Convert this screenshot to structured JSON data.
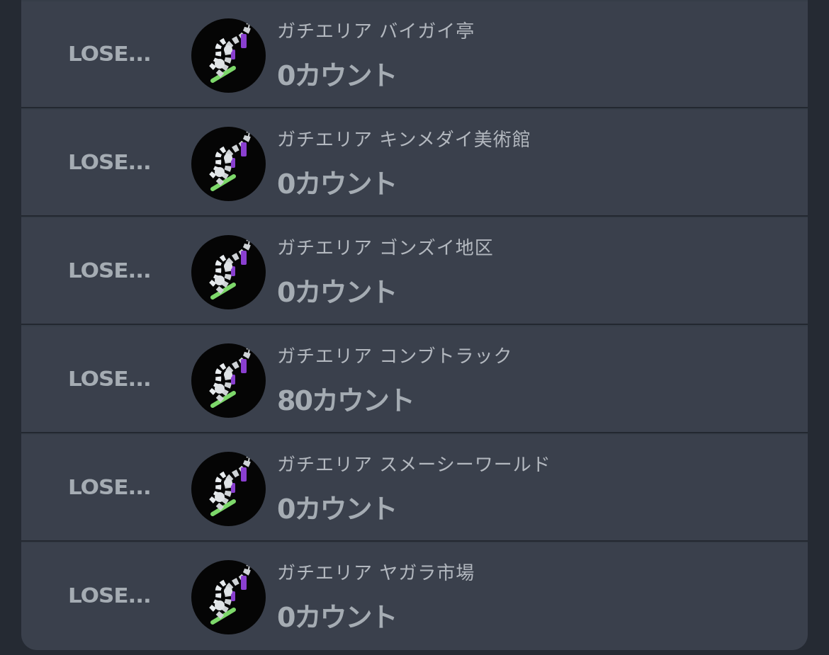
{
  "matches": [
    {
      "result": "LOSE...",
      "stage": "ガチエリア バイガイ亭",
      "count": "0カウント"
    },
    {
      "result": "LOSE...",
      "stage": "ガチエリア キンメダイ美術館",
      "count": "0カウント"
    },
    {
      "result": "LOSE...",
      "stage": "ガチエリア ゴンズイ地区",
      "count": "0カウント"
    },
    {
      "result": "LOSE...",
      "stage": "ガチエリア コンブトラック",
      "count": "80カウント"
    },
    {
      "result": "LOSE...",
      "stage": "ガチエリア スメーシーワールド",
      "count": "0カウント"
    },
    {
      "result": "LOSE...",
      "stage": "ガチエリア ヤガラ市場",
      "count": "0カウント"
    }
  ],
  "weapon_icon": "weapon-icon"
}
